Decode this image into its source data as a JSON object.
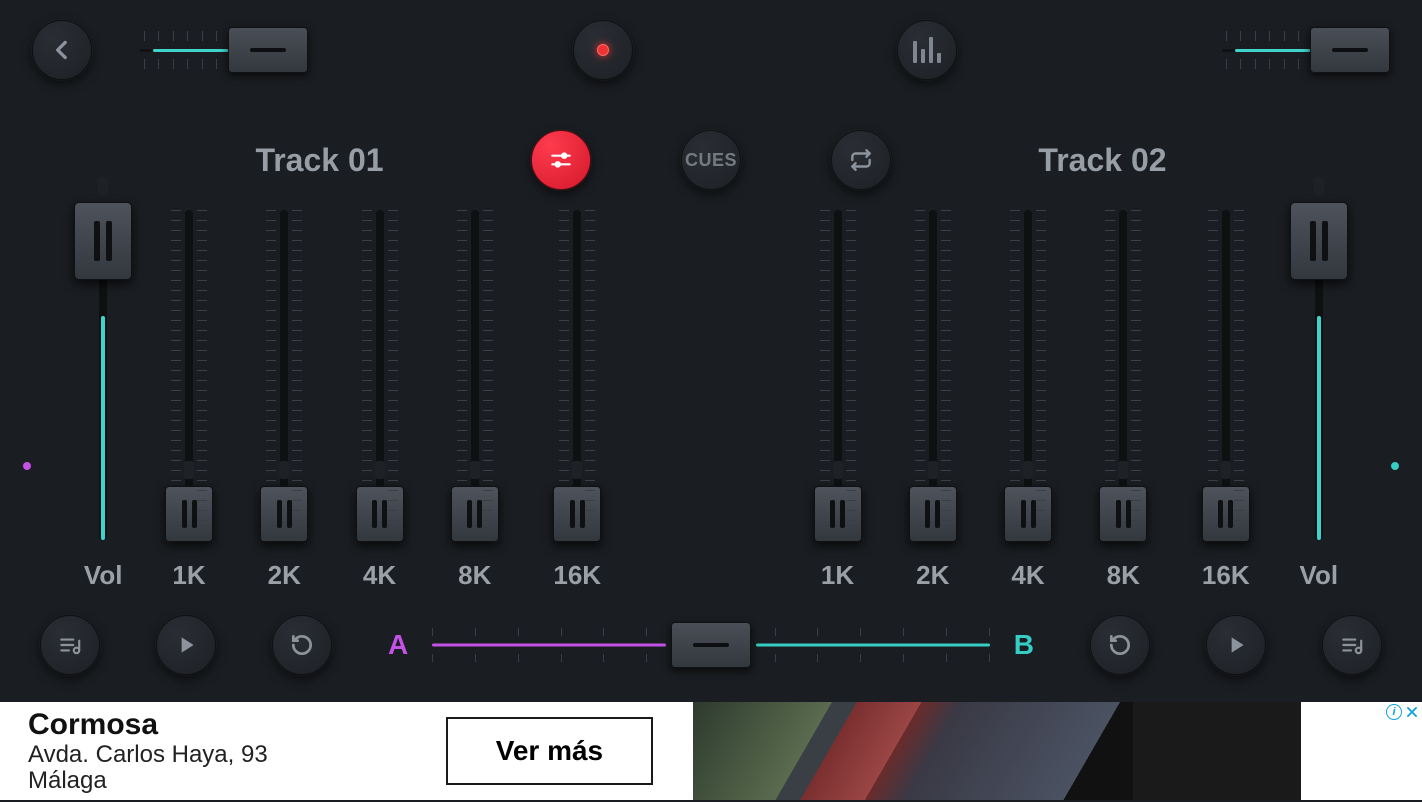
{
  "topbar": {
    "tempo_left_fill_pct": 62,
    "tempo_right_fill_pct": 62
  },
  "deck_a": {
    "title": "Track 01",
    "vol_label": "Vol",
    "vol_fill_pct": 68,
    "eq": [
      {
        "label": "1K"
      },
      {
        "label": "2K"
      },
      {
        "label": "4K"
      },
      {
        "label": "8K"
      },
      {
        "label": "16K"
      }
    ],
    "dot_color": "#c552e6"
  },
  "deck_b": {
    "title": "Track 02",
    "vol_label": "Vol",
    "vol_fill_pct": 68,
    "eq": [
      {
        "label": "1K"
      },
      {
        "label": "2K"
      },
      {
        "label": "4K"
      },
      {
        "label": "8K"
      },
      {
        "label": "16K"
      }
    ],
    "dot_color": "#35cdc4"
  },
  "center": {
    "cues_label": "CUES"
  },
  "crossfader": {
    "a_label": "A",
    "b_label": "B",
    "position_pct": 50
  },
  "ad": {
    "title": "Cormosa",
    "line1": "Avda. Carlos Haya, 93",
    "line2": "Málaga",
    "cta": "Ver más"
  }
}
